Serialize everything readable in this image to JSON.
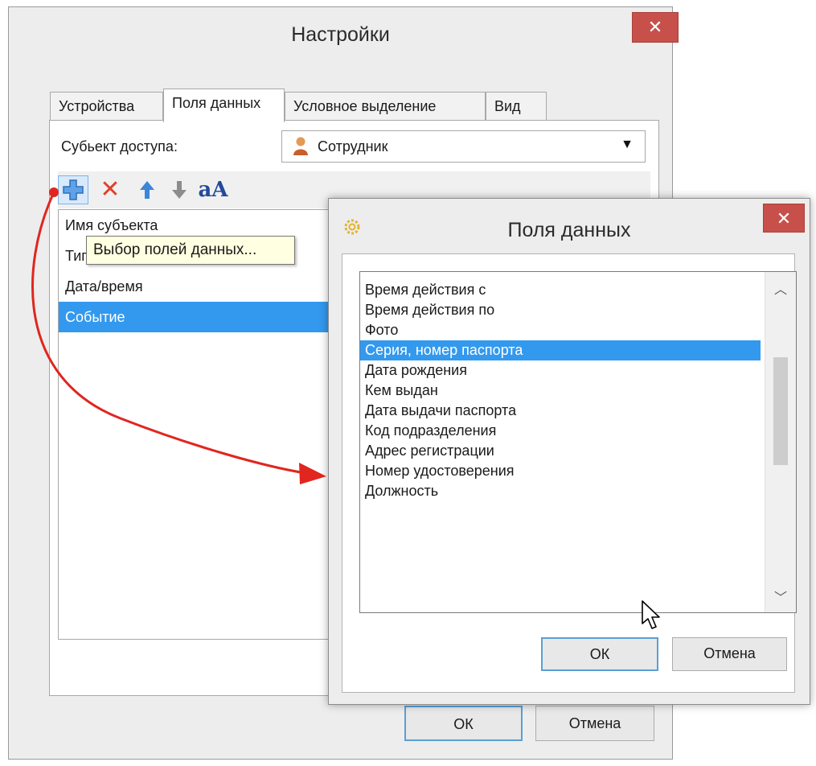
{
  "main_window": {
    "title": "Настройки",
    "close_glyph": "✕",
    "tabs": [
      "Устройства",
      "Поля данных",
      "Условное выделение",
      "Вид"
    ],
    "active_tab": "Поля данных",
    "subject_label": "Субьект доступа:",
    "subject_value": "Сотрудник",
    "subject_icon": "person-icon",
    "toolbar": {
      "icons": [
        "add-fields-icon",
        "delete-icon",
        "move-up-icon",
        "move-down-icon",
        "font-icon"
      ],
      "font_glyph": "aA"
    },
    "fields": [
      {
        "label": "Имя субъекта",
        "selected": false
      },
      {
        "label": "Тип",
        "selected": false
      },
      {
        "label": "Дата/время",
        "selected": false
      },
      {
        "label": "Событие",
        "selected": true
      }
    ],
    "tooltip": "Выбор полей данных...",
    "ok_label": "ОК",
    "cancel_label": "Отмена"
  },
  "dialog": {
    "title": "Поля данных",
    "close_glyph": "✕",
    "icon": "gear-icon",
    "items": [
      {
        "label": "Время действия с",
        "selected": false
      },
      {
        "label": "Время действия по",
        "selected": false
      },
      {
        "label": "Фото",
        "selected": false
      },
      {
        "label": "Серия, номер паспорта",
        "selected": true
      },
      {
        "label": "Дата рождения",
        "selected": false
      },
      {
        "label": "Кем выдан",
        "selected": false
      },
      {
        "label": "Дата выдачи паспорта",
        "selected": false
      },
      {
        "label": "Код подразделения",
        "selected": false
      },
      {
        "label": "Адрес регистрации",
        "selected": false
      },
      {
        "label": "Номер удостоверения",
        "selected": false
      },
      {
        "label": "Должность",
        "selected": false
      }
    ],
    "ok_label": "ОК",
    "cancel_label": "Отмена"
  },
  "colors": {
    "selection": "#3399ee",
    "close_button": "#c7514a",
    "annotation_arrow": "#e0261f",
    "tooltip_bg": "#ffffe1"
  }
}
